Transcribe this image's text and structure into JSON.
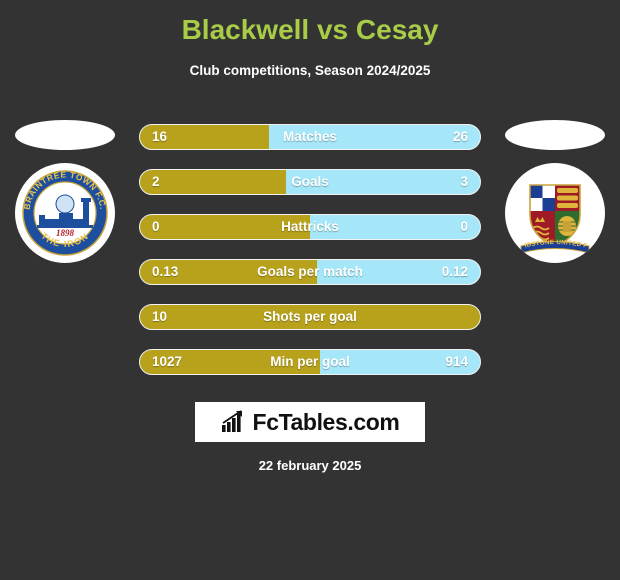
{
  "header": {
    "title": "Blackwell vs Cesay",
    "subtitle": "Club competitions, Season 2024/2025",
    "title_color": "#a8cc48"
  },
  "badges": {
    "home": {
      "name": "braintree-town-fc-crest",
      "club": "BRAINTREE TOWN F.C.",
      "nickname": "THE IRON",
      "founded": "1898"
    },
    "away": {
      "name": "maidstone-united-crest",
      "club": "MAIDSTONE UNITED F.C."
    }
  },
  "colors": {
    "background": "#333333",
    "home_bar": "#b8a21c",
    "away_bar": "#a5e7f8",
    "text": "#ffffff"
  },
  "chart_data": {
    "type": "bar",
    "title": "Blackwell vs Cesay",
    "subtitle": "Club competitions, Season 2024/2025",
    "orientation": "horizontal-diverging",
    "categories": [
      "Matches",
      "Goals",
      "Hattricks",
      "Goals per match",
      "Shots per goal",
      "Min per goal"
    ],
    "series": [
      {
        "name": "Blackwell",
        "values": [
          "16",
          "2",
          "0",
          "0.13",
          "10",
          "1027"
        ]
      },
      {
        "name": "Cesay",
        "values": [
          "26",
          "3",
          "0",
          "0.12",
          "",
          "914"
        ]
      }
    ],
    "home_fill_percent": [
      38,
      43,
      50,
      52,
      100,
      53
    ],
    "grid": false,
    "legend": false
  },
  "rows": [
    {
      "label": "Matches",
      "home": "16",
      "away": "26",
      "fill": 38
    },
    {
      "label": "Goals",
      "home": "2",
      "away": "3",
      "fill": 43
    },
    {
      "label": "Hattricks",
      "home": "0",
      "away": "0",
      "fill": 50
    },
    {
      "label": "Goals per match",
      "home": "0.13",
      "away": "0.12",
      "fill": 52
    },
    {
      "label": "Shots per goal",
      "home": "10",
      "away": "",
      "fill": 100
    },
    {
      "label": "Min per goal",
      "home": "1027",
      "away": "914",
      "fill": 53
    }
  ],
  "footer": {
    "logo_text": "FcTables.com",
    "logo_icon": "bar-chart-arrow-icon",
    "date": "22 february 2025"
  }
}
